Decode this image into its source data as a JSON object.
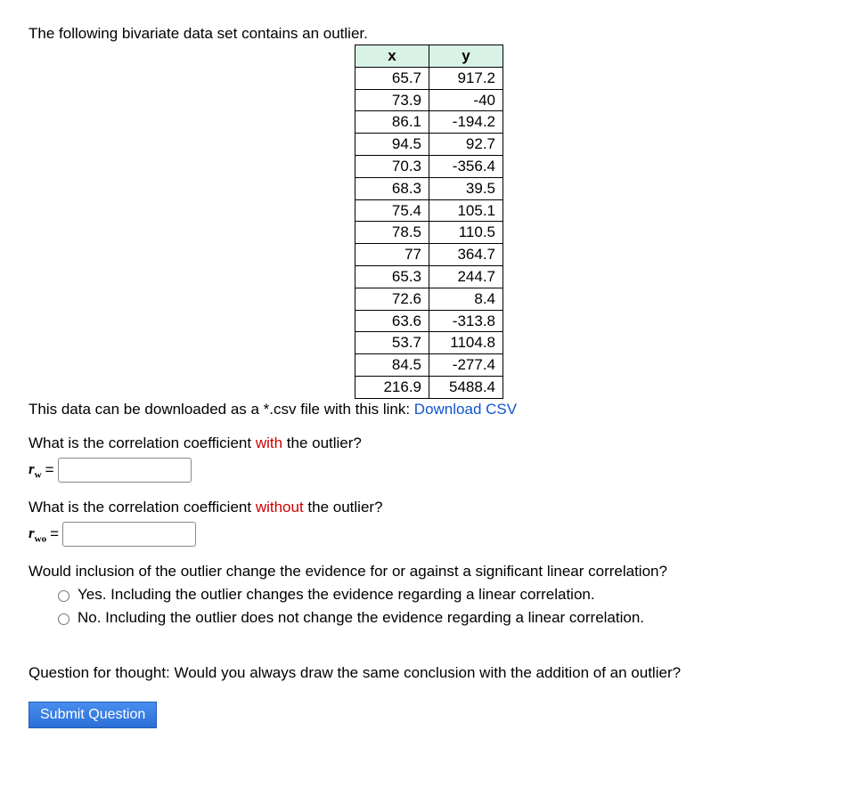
{
  "intro": "The following bivariate data set contains an outlier.",
  "table": {
    "headers": {
      "x": "x",
      "y": "y"
    },
    "rows": [
      {
        "x": "65.7",
        "y": "917.2"
      },
      {
        "x": "73.9",
        "y": "-40"
      },
      {
        "x": "86.1",
        "y": "-194.2"
      },
      {
        "x": "94.5",
        "y": "92.7"
      },
      {
        "x": "70.3",
        "y": "-356.4"
      },
      {
        "x": "68.3",
        "y": "39.5"
      },
      {
        "x": "75.4",
        "y": "105.1"
      },
      {
        "x": "78.5",
        "y": "110.5"
      },
      {
        "x": "77",
        "y": "364.7"
      },
      {
        "x": "65.3",
        "y": "244.7"
      },
      {
        "x": "72.6",
        "y": "8.4"
      },
      {
        "x": "63.6",
        "y": "-313.8"
      },
      {
        "x": "53.7",
        "y": "1104.8"
      },
      {
        "x": "84.5",
        "y": "-277.4"
      },
      {
        "x": "216.9",
        "y": "5488.4"
      }
    ]
  },
  "download": {
    "prefix": "This data can be downloaded as a *.csv file with this link:  ",
    "link_text": "Download CSV"
  },
  "q_with": {
    "prefix": "What is the correlation coefficient ",
    "emph": "with",
    "suffix": " the outlier?",
    "var_letter": "r",
    "var_sub": "w",
    "equals": " = "
  },
  "q_without": {
    "prefix": "What is the correlation coefficient ",
    "emph": "without",
    "suffix": " the outlier?",
    "var_letter": "r",
    "var_sub": "wo",
    "equals": " = "
  },
  "q_radio": {
    "prompt": "Would inclusion of the outlier change the evidence for or against a significant linear correlation?",
    "opt_yes": "Yes. Including the outlier changes the evidence regarding a linear correlation.",
    "opt_no": "No. Including the outlier does not change the evidence regarding a linear correlation."
  },
  "thought": "Question for thought: Would you always draw the same conclusion with the addition of an outlier?",
  "submit_label": "Submit Question"
}
